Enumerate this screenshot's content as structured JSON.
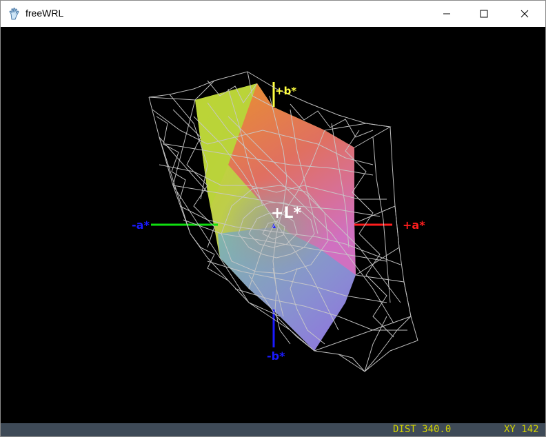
{
  "window": {
    "title": "freeWRL",
    "icon": "freewrl-hand-icon",
    "controls": [
      "minimize",
      "maximize",
      "close"
    ]
  },
  "scene": {
    "axes": {
      "plus_a": "+a*",
      "minus_a": "-a*",
      "plus_b": "+b*",
      "minus_b": "-b*",
      "plus_l": "+L*"
    },
    "colors": {
      "plus_a": "#ff1e1e",
      "minus_a": "#1a1aff",
      "plus_b": "#ffff40",
      "minus_b": "#1a1aff",
      "plus_l": "#ffffff",
      "a_axis_negative_line": "#10e010",
      "wireframe": "#c8c8c8"
    }
  },
  "status": {
    "dist": "DIST 340.0",
    "xy": "XY 142"
  }
}
